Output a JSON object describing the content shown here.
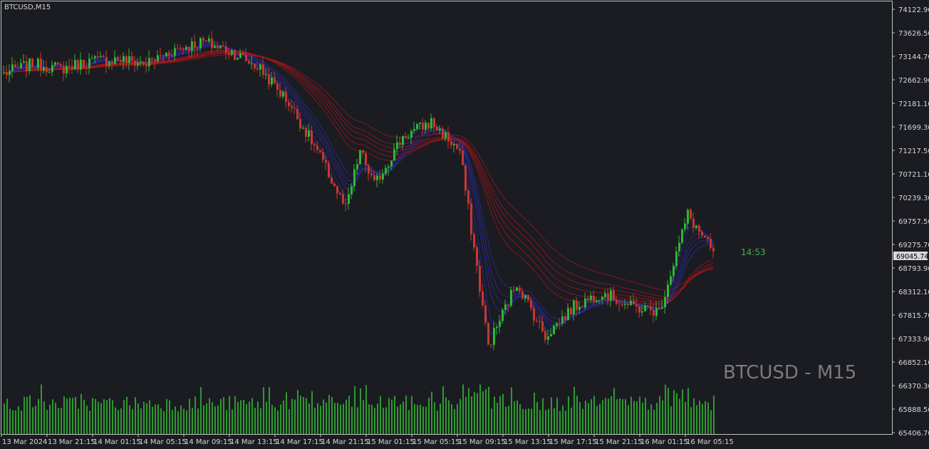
{
  "chart_data": {
    "type": "candlestick",
    "symbol_label": "BTCUSD,M15",
    "watermark": "BTCUSD - M15",
    "timer": "14:53",
    "current_price_label": "69045.74",
    "current_price": 69045.74,
    "y_ticks": [
      "74122.90",
      "73626.50",
      "73144.70",
      "72662.90",
      "72181.10",
      "71699.30",
      "71217.50",
      "70721.10",
      "70239.30",
      "69757.50",
      "69275.70",
      "68793.90",
      "68312.10",
      "67815.70",
      "67333.90",
      "66852.10",
      "66370.30",
      "65888.50",
      "65406.70"
    ],
    "ylim": [
      65406.7,
      74122.9
    ],
    "x_ticks": [
      "13 Mar 2024",
      "13 Mar 21:15",
      "14 Mar 01:15",
      "14 Mar 05:15",
      "14 Mar 09:15",
      "14 Mar 13:15",
      "14 Mar 17:15",
      "14 Mar 21:15",
      "15 Mar 01:15",
      "15 Mar 05:15",
      "15 Mar 09:15",
      "15 Mar 13:15",
      "15 Mar 17:15",
      "15 Mar 21:15",
      "16 Mar 01:15",
      "16 Mar 05:15"
    ],
    "bar_count": 250,
    "price_path": [
      [
        0,
        72800
      ],
      [
        10,
        73000
      ],
      [
        20,
        72900
      ],
      [
        30,
        73050
      ],
      [
        40,
        73100
      ],
      [
        50,
        73000
      ],
      [
        60,
        73300
      ],
      [
        70,
        73450
      ],
      [
        80,
        73250
      ],
      [
        90,
        72900
      ],
      [
        100,
        72200
      ],
      [
        110,
        71200
      ],
      [
        120,
        70000
      ],
      [
        125,
        71200
      ],
      [
        130,
        70500
      ],
      [
        140,
        71500
      ],
      [
        150,
        71800
      ],
      [
        160,
        71200
      ],
      [
        170,
        67200
      ],
      [
        180,
        68500
      ],
      [
        190,
        67400
      ],
      [
        200,
        68000
      ],
      [
        210,
        68300
      ],
      [
        220,
        68000
      ],
      [
        230,
        67900
      ],
      [
        240,
        69900
      ],
      [
        250,
        69000
      ]
    ],
    "colors": {
      "background": "#1b1c22",
      "up_candle": "#2fb82f",
      "down_candle": "#c8372d",
      "volume": "#2d9a2d",
      "ribbon_fast": "#2a2db5",
      "ribbon_slow": "#b4141a",
      "axis_text": "#d7d7d7",
      "price_label_bg": "#d9d9d9",
      "timer": "#40b540",
      "watermark": "#7b7b7b"
    }
  }
}
